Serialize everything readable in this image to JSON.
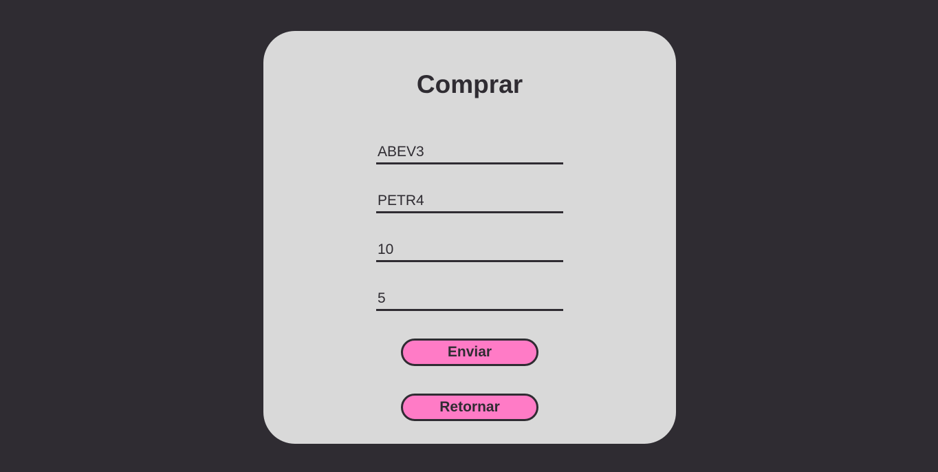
{
  "form": {
    "title": "Comprar",
    "fields": [
      {
        "value": "ABEV3"
      },
      {
        "value": "PETR4"
      },
      {
        "value": "10"
      },
      {
        "value": "5"
      }
    ],
    "submit_label": "Enviar",
    "back_label": "Retornar"
  },
  "colors": {
    "background": "#2f2c32",
    "card": "#d9d9d9",
    "button": "#ff7bc6",
    "text": "#2f2c32"
  }
}
